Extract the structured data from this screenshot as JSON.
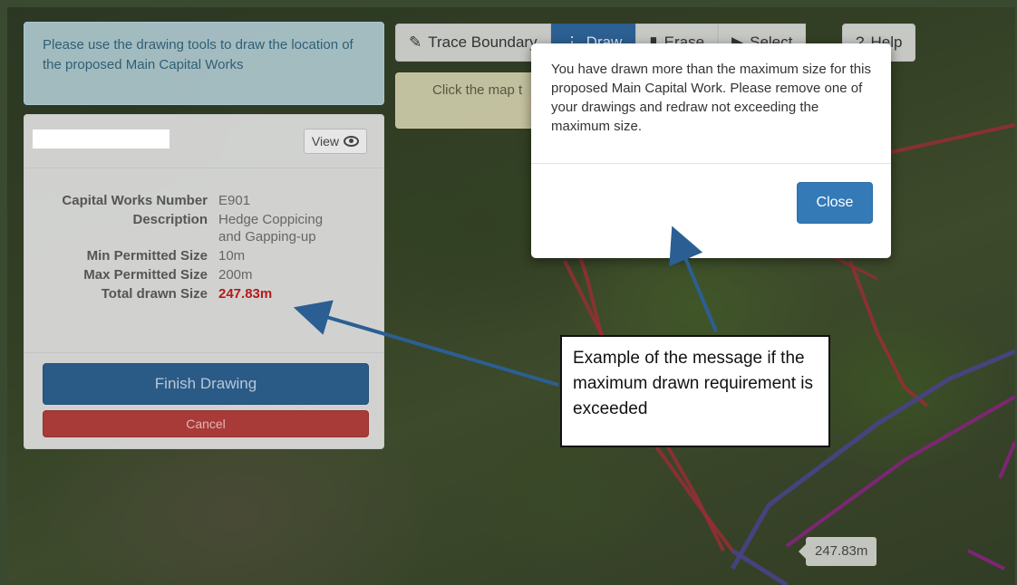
{
  "instructions": {
    "text": "Please use the drawing tools to draw the location of the proposed Main Capital Works"
  },
  "details_panel": {
    "view_label": "View",
    "rows": [
      {
        "label": "Capital Works Number",
        "value": "E901"
      },
      {
        "label": "Description",
        "value": "Hedge Coppicing and Gapping-up"
      },
      {
        "label": "Min Permitted Size",
        "value": "10m"
      },
      {
        "label": "Max Permitted Size",
        "value": "200m"
      },
      {
        "label": "Total drawn Size",
        "value": "247.83m"
      }
    ],
    "finish_label": "Finish Drawing",
    "cancel_label": "Cancel"
  },
  "toolbar": {
    "tools": [
      {
        "label": "Trace Boundary",
        "icon": "pencil-icon"
      },
      {
        "label": "Draw",
        "icon": "draw-icon"
      },
      {
        "label": "Erase",
        "icon": "eraser-icon"
      },
      {
        "label": "Select",
        "icon": "cursor-icon"
      }
    ],
    "help_label": "Help",
    "active_tool": "Draw"
  },
  "hint": {
    "text": "Click the map t"
  },
  "modal": {
    "message": "You have drawn more than the maximum size for this proposed Main Capital Work. Please remove one of your drawings and redraw not exceeding the maximum size.",
    "close_label": "Close"
  },
  "callout": {
    "text": "Example of the message if the maximum drawn requirement is exceeded"
  },
  "map_label": {
    "text": "247.83m"
  },
  "colors": {
    "accent_blue": "#337ab7",
    "warning_red": "#b31b1b",
    "arrow_blue": "#2b5f93",
    "boundary_red": "#e0434f",
    "boundary_purple": "#6a63c6",
    "boundary_magenta": "#c434b8"
  }
}
